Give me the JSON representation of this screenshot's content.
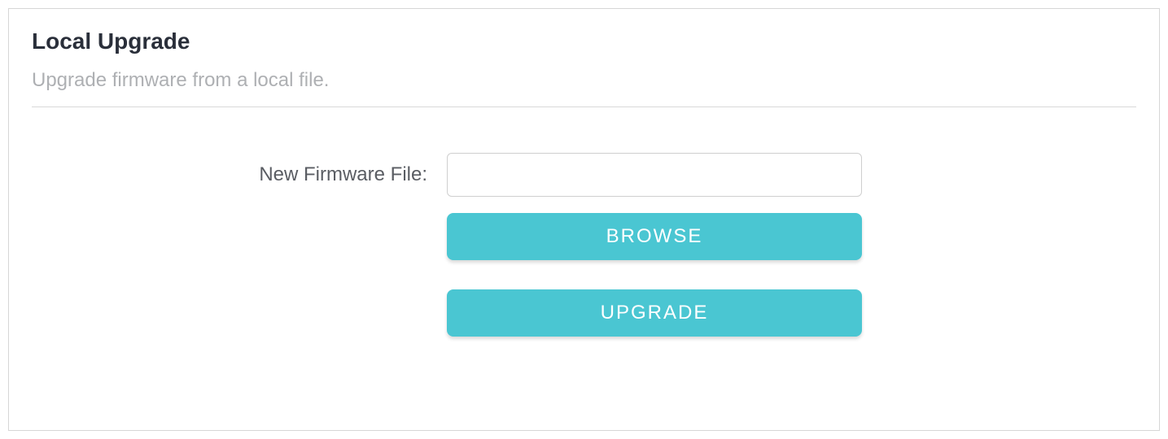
{
  "panel": {
    "title": "Local Upgrade",
    "description": "Upgrade firmware from a local file."
  },
  "form": {
    "firmware_label": "New Firmware File:",
    "firmware_value": "",
    "browse_label": "BROWSE",
    "upgrade_label": "UPGRADE"
  },
  "colors": {
    "accent": "#4ac6d2"
  }
}
